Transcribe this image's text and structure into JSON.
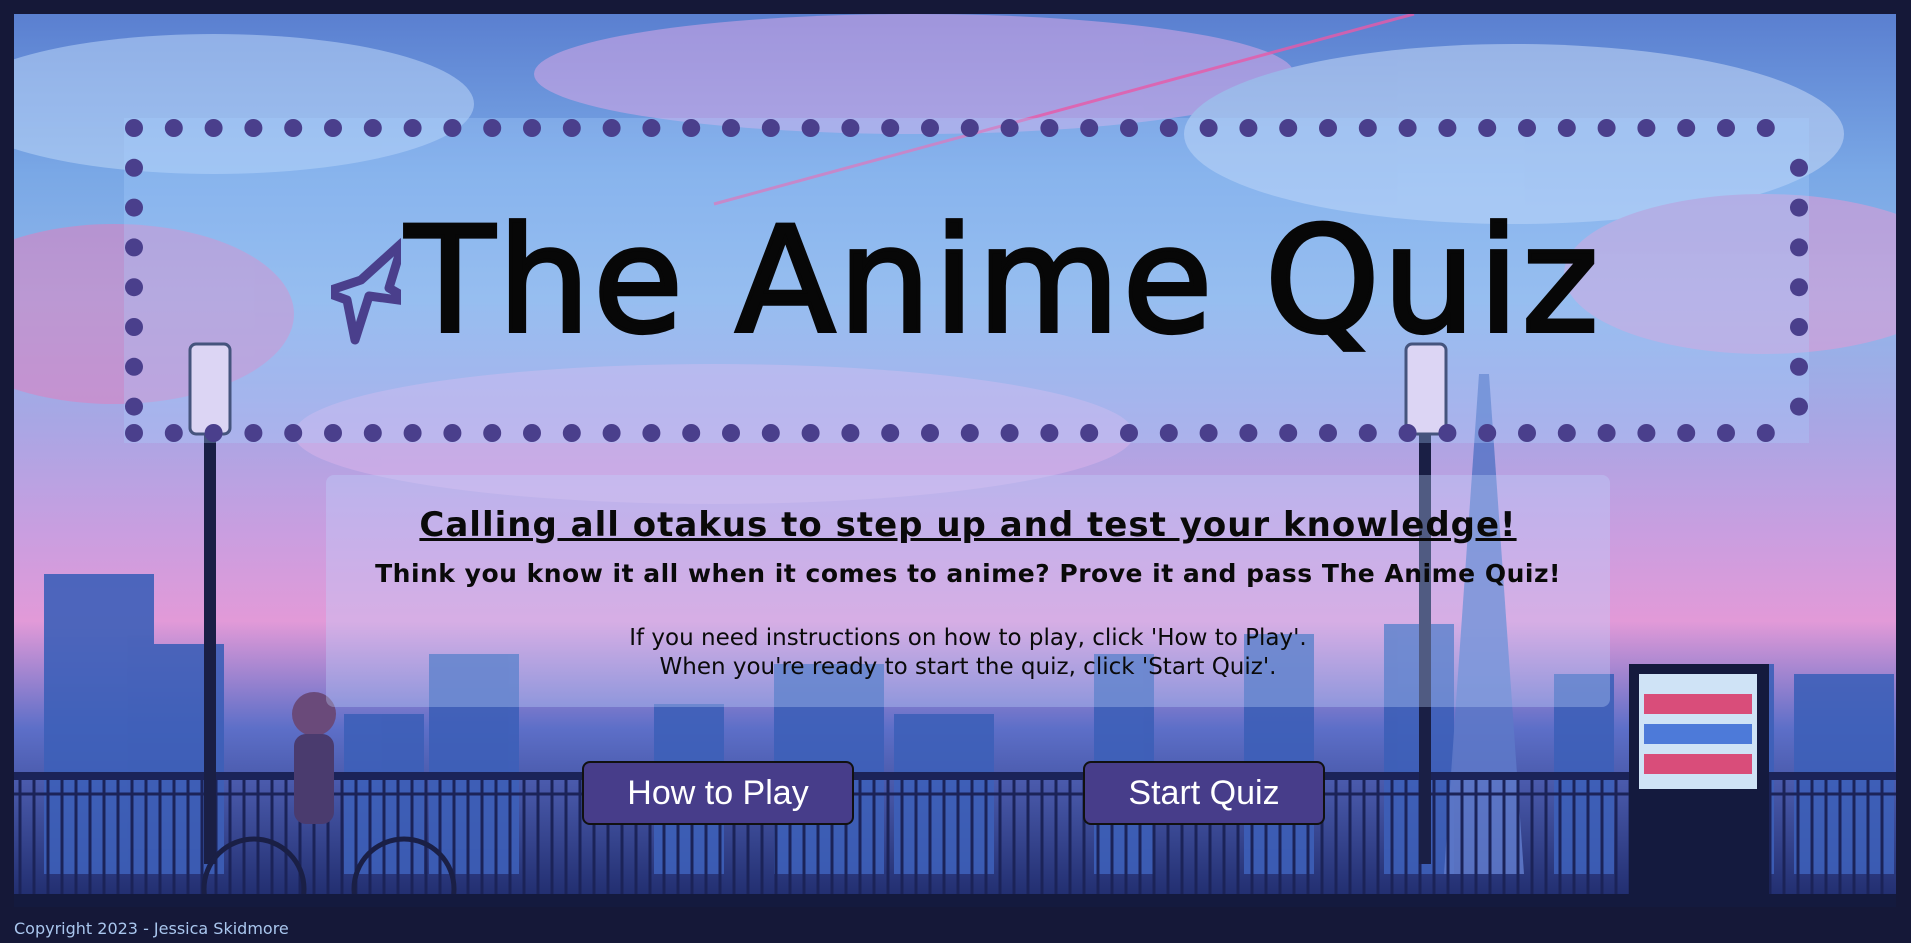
{
  "header": {
    "title": "The Anime Quiz"
  },
  "intro": {
    "headline": "Calling all otakus to step up and test your knowledge!",
    "subline": "Think you know it all when it comes to anime? Prove it and pass The Anime Quiz!",
    "instruction_1": "If you need instructions on how to play, click 'How to Play'.",
    "instruction_2": "When you're ready to start the quiz, click 'Start Quiz'."
  },
  "buttons": {
    "how_to_play": "How to Play",
    "start_quiz": "Start Quiz"
  },
  "footer": {
    "copyright": "Copyright 2023 - Jessica Skidmore"
  },
  "icons": [
    "star-icon"
  ],
  "colors": {
    "accent": "#473d8a",
    "dot": "#4a3f8c",
    "page_bg": "#151838"
  }
}
